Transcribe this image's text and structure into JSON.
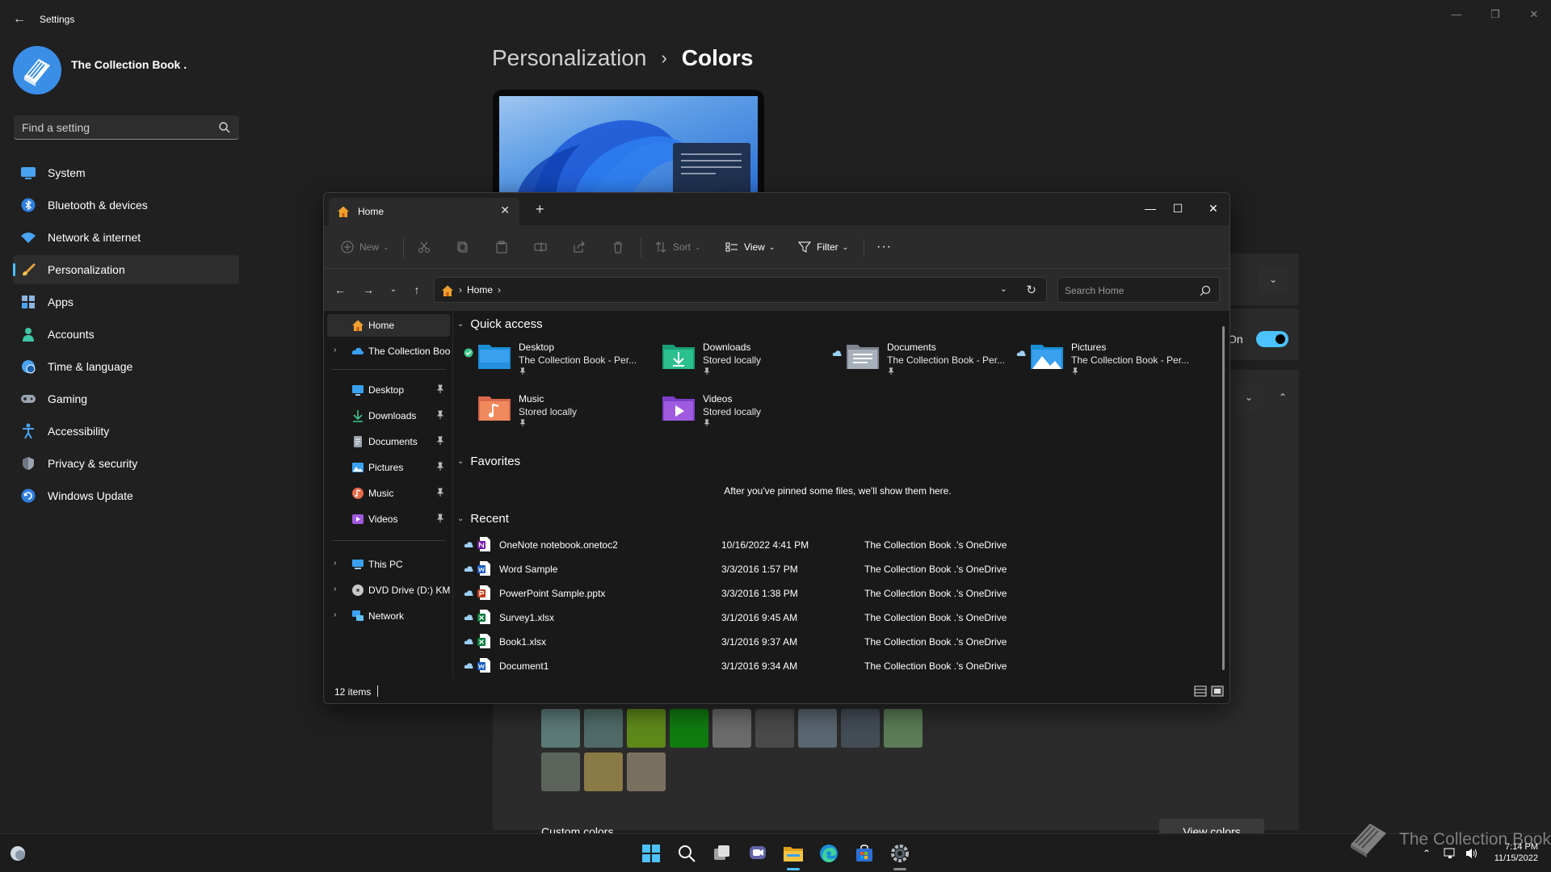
{
  "settings": {
    "title": "Settings",
    "profile_name": "The Collection Book .",
    "search_placeholder": "Find a setting",
    "nav": [
      {
        "label": "System",
        "icon": "monitor-icon"
      },
      {
        "label": "Bluetooth & devices",
        "icon": "bluetooth-icon"
      },
      {
        "label": "Network & internet",
        "icon": "wifi-icon"
      },
      {
        "label": "Personalization",
        "icon": "brush-icon",
        "active": true
      },
      {
        "label": "Apps",
        "icon": "apps-icon"
      },
      {
        "label": "Accounts",
        "icon": "person-icon"
      },
      {
        "label": "Time & language",
        "icon": "globe-clock-icon"
      },
      {
        "label": "Gaming",
        "icon": "gamepad-icon"
      },
      {
        "label": "Accessibility",
        "icon": "accessibility-icon"
      },
      {
        "label": "Privacy & security",
        "icon": "shield-icon"
      },
      {
        "label": "Windows Update",
        "icon": "update-icon"
      }
    ],
    "breadcrumb_parent": "Personalization",
    "breadcrumb_current": "Colors",
    "toggle_label": "On",
    "custom_colors_label": "Custom colors",
    "view_colors_label": "View colors",
    "swatch_colors": [
      "#5b7a78",
      "#4f6b68",
      "#5e8a1a",
      "#107c10",
      "#6b6b6b",
      "#4a4a4a",
      "#5a6670",
      "#434d56",
      "#5a7c56",
      "#5c635b",
      "#8a7a45",
      "#7a7060"
    ]
  },
  "explorer": {
    "tab_label": "Home",
    "toolbar": {
      "new_label": "New",
      "sort_label": "Sort",
      "view_label": "View",
      "filter_label": "Filter"
    },
    "address": {
      "location": "Home"
    },
    "search_placeholder": "Search Home",
    "nav": {
      "home": "Home",
      "onedrive": "The Collection Boo",
      "pinned": [
        "Desktop",
        "Downloads",
        "Documents",
        "Pictures",
        "Music",
        "Videos"
      ],
      "this_pc": "This PC",
      "dvd": "DVD Drive (D:) KMS",
      "network": "Network"
    },
    "quick_access": {
      "title": "Quick access",
      "items": [
        {
          "name": "Desktop",
          "sub": "The Collection Book - Per...",
          "icon": "desktop-folder-icon"
        },
        {
          "name": "Downloads",
          "sub": "Stored locally",
          "icon": "downloads-folder-icon"
        },
        {
          "name": "Documents",
          "sub": "The Collection Book - Per...",
          "icon": "documents-folder-icon"
        },
        {
          "name": "Pictures",
          "sub": "The Collection Book - Per...",
          "icon": "pictures-folder-icon"
        },
        {
          "name": "Music",
          "sub": "Stored locally",
          "icon": "music-folder-icon"
        },
        {
          "name": "Videos",
          "sub": "Stored locally",
          "icon": "videos-folder-icon"
        }
      ]
    },
    "favorites": {
      "title": "Favorites",
      "empty_text": "After you've pinned some files, we'll show them here."
    },
    "recent": {
      "title": "Recent",
      "rows": [
        {
          "name": "OneNote notebook.onetoc2",
          "date": "10/16/2022 4:41 PM",
          "location": "The Collection Book .'s OneDrive",
          "icon": "onenote-file-icon"
        },
        {
          "name": "Word Sample",
          "date": "3/3/2016 1:57 PM",
          "location": "The Collection Book .'s OneDrive",
          "icon": "word-file-icon"
        },
        {
          "name": "PowerPoint Sample.pptx",
          "date": "3/3/2016 1:38 PM",
          "location": "The Collection Book .'s OneDrive",
          "icon": "powerpoint-file-icon"
        },
        {
          "name": "Survey1.xlsx",
          "date": "3/1/2016 9:45 AM",
          "location": "The Collection Book .'s OneDrive",
          "icon": "excel-file-icon"
        },
        {
          "name": "Book1.xlsx",
          "date": "3/1/2016 9:37 AM",
          "location": "The Collection Book .'s OneDrive",
          "icon": "excel-file-icon"
        },
        {
          "name": "Document1",
          "date": "3/1/2016 9:34 AM",
          "location": "The Collection Book .'s OneDrive",
          "icon": "word-file-icon"
        }
      ]
    },
    "status": {
      "item_count": "12 items"
    }
  },
  "taskbar": {
    "time": "7:14 PM",
    "date": "11/15/2022",
    "watermark": "The Collection Book"
  },
  "colors": {
    "accent": "#4cc2ff",
    "folder": "#f0c24b",
    "onedrive": "#3aa0f0"
  }
}
